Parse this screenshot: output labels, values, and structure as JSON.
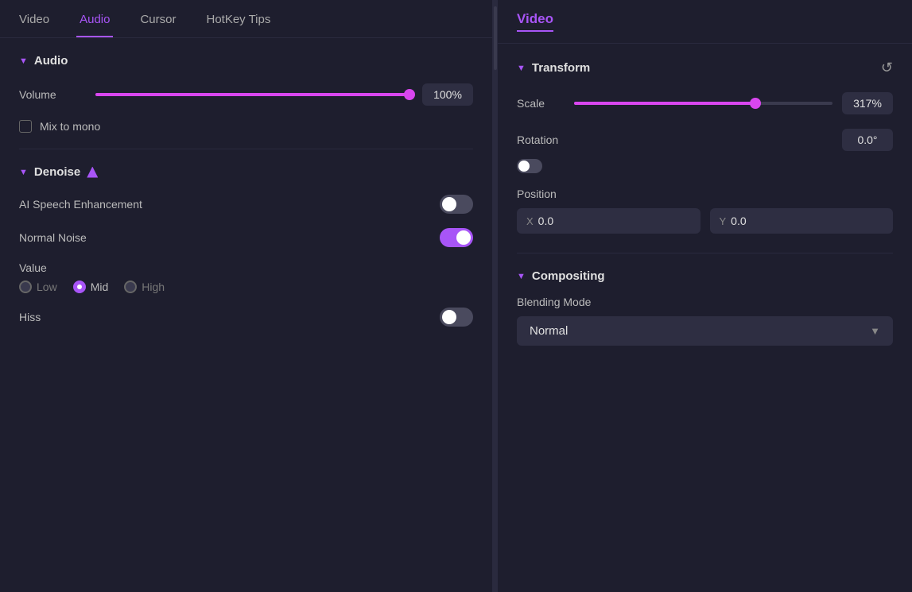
{
  "left": {
    "tabs": [
      {
        "label": "Video",
        "active": false
      },
      {
        "label": "Audio",
        "active": true
      },
      {
        "label": "Cursor",
        "active": false
      },
      {
        "label": "HotKey Tips",
        "active": false
      }
    ],
    "audio": {
      "section_title": "Audio",
      "volume_label": "Volume",
      "volume_value": "100%",
      "volume_pct": 100,
      "mix_to_mono": "Mix to mono"
    },
    "denoise": {
      "section_title": "Denoise",
      "ai_label": "AI Speech Enhancement",
      "ai_on": false,
      "normal_noise_label": "Normal Noise",
      "normal_noise_on": true,
      "value_label": "Value",
      "radio_options": [
        {
          "label": "Low",
          "selected": false
        },
        {
          "label": "Mid",
          "selected": true
        },
        {
          "label": "High",
          "selected": false
        }
      ],
      "hiss_label": "Hiss",
      "hiss_on": false
    }
  },
  "right": {
    "title": "Video",
    "transform": {
      "section_title": "Transform",
      "scale_label": "Scale",
      "scale_value": "317%",
      "scale_pct": 70,
      "rotation_label": "Rotation",
      "rotation_value": "0.0°",
      "position_label": "Position",
      "pos_x_label": "X",
      "pos_x_value": "0.0",
      "pos_y_label": "Y",
      "pos_y_value": "0.0"
    },
    "compositing": {
      "section_title": "Compositing",
      "blending_label": "Blending Mode",
      "blending_value": "Normal"
    }
  }
}
